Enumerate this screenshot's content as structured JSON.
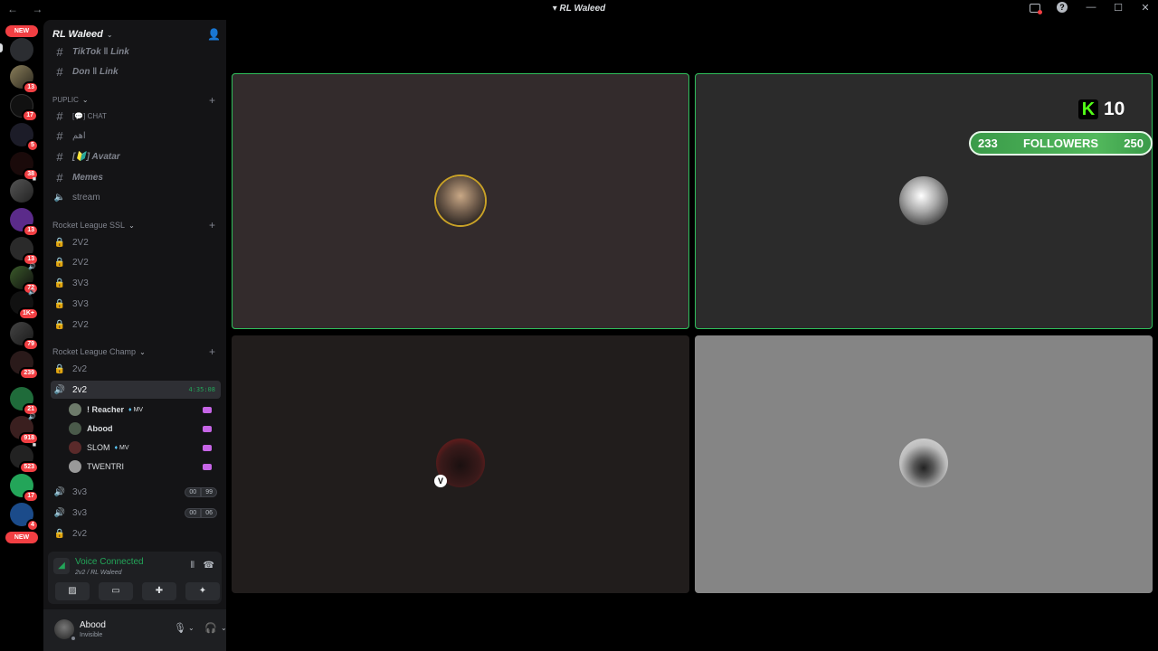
{
  "window": {
    "title": "RL Waleed",
    "nav": "← →"
  },
  "rail": {
    "new_top": "NEW",
    "new_bottom": "NEW",
    "badges": [
      "13",
      "17",
      "5",
      "38",
      "13",
      "13",
      "72",
      "1K+",
      "79",
      "239",
      "21",
      "918",
      "523",
      "17",
      "4"
    ]
  },
  "guild": {
    "name": "RL Waleed"
  },
  "channels": {
    "top": [
      {
        "icon": "#",
        "name": "TikTok ‖ Link"
      },
      {
        "icon": "#",
        "name": "Don ‖ Link"
      }
    ],
    "public_label": "PUPLIC",
    "public": [
      {
        "icon": "#",
        "name": "CHAT"
      },
      {
        "icon": "#",
        "name": "اهم"
      },
      {
        "icon": "#",
        "name": "Avatar"
      },
      {
        "icon": "#",
        "name": "Memes"
      },
      {
        "icon": "🔊",
        "name": "stream"
      }
    ],
    "ssl_label": "Rocket League SSL",
    "ssl": [
      "2V2",
      "2V2",
      "3V3",
      "3V3",
      "2V2"
    ],
    "champ_label": "Rocket League Champ",
    "champ_locked": "2v2",
    "active_channel": "2v2",
    "active_timer": "4:35:08",
    "members": [
      {
        "name": "! Reacher",
        "tag": "MV"
      },
      {
        "name": "Abood",
        "tag": ""
      },
      {
        "name": "SLOM",
        "tag": "MV"
      },
      {
        "name": "TWENTRI",
        "tag": ""
      }
    ],
    "after": [
      {
        "name": "3v3",
        "c1": "00",
        "c2": "99"
      },
      {
        "name": "3v3",
        "c1": "00",
        "c2": "06"
      }
    ],
    "last_locked": "2v2"
  },
  "voice": {
    "title": "Voice Connected",
    "sub": "2v2 / RL Waleed"
  },
  "user": {
    "name": "Abood",
    "status": "Invisible"
  },
  "overlay": {
    "k_count": "10",
    "followers_current": "233",
    "followers_label": "FOLLOWERS",
    "followers_goal": "250"
  },
  "colors": {
    "speaking": "#2fbf5b",
    "accent": "#23a559",
    "kick": "#53fc18"
  }
}
